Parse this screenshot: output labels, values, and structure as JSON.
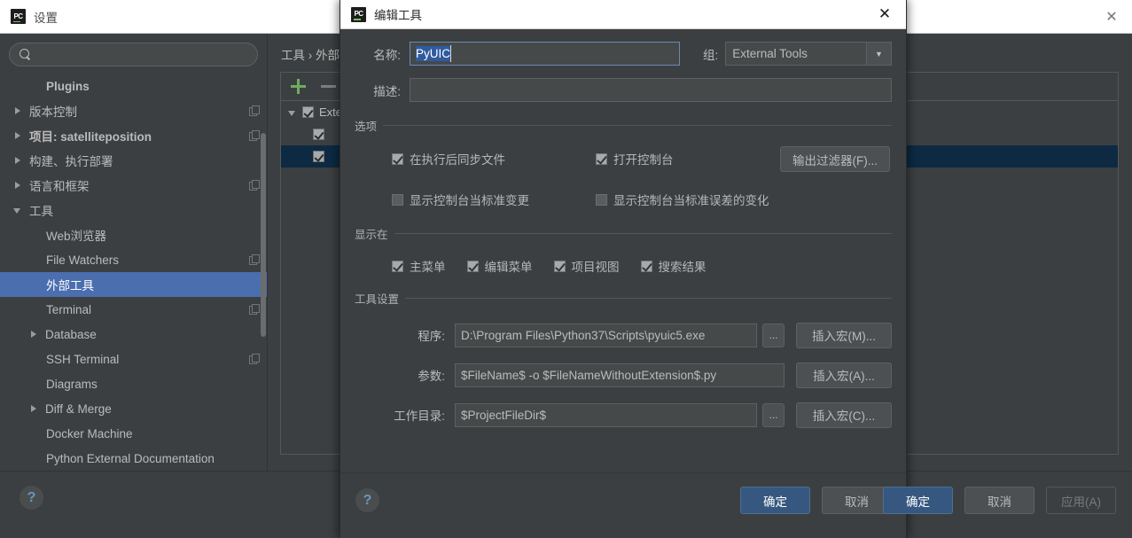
{
  "settings_window": {
    "title": "设置",
    "logo_text": "PC",
    "close_icon": "✕",
    "search": {
      "value": "",
      "placeholder": ""
    },
    "sidebar": {
      "items": [
        {
          "label": "Plugins",
          "arrow": "none",
          "bold": true,
          "indent": true,
          "copy": false,
          "selected": false
        },
        {
          "label": "版本控制",
          "arrow": "closed",
          "bold": false,
          "indent": false,
          "copy": true,
          "selected": false
        },
        {
          "label": "项目: satelliteposition",
          "arrow": "closed",
          "bold": true,
          "indent": false,
          "copy": true,
          "selected": false
        },
        {
          "label": "构建、执行部署",
          "arrow": "closed",
          "bold": false,
          "indent": false,
          "copy": false,
          "selected": false
        },
        {
          "label": "语言和框架",
          "arrow": "closed",
          "bold": false,
          "indent": false,
          "copy": true,
          "selected": false
        },
        {
          "label": "工具",
          "arrow": "open",
          "bold": false,
          "indent": false,
          "copy": false,
          "selected": false
        },
        {
          "label": "Web浏览器",
          "arrow": "none",
          "bold": false,
          "indent": true,
          "copy": false,
          "selected": false
        },
        {
          "label": "File Watchers",
          "arrow": "none",
          "bold": false,
          "indent": true,
          "copy": true,
          "selected": false
        },
        {
          "label": "外部工具",
          "arrow": "none",
          "bold": false,
          "indent": true,
          "copy": false,
          "selected": true
        },
        {
          "label": "Terminal",
          "arrow": "none",
          "bold": false,
          "indent": true,
          "copy": true,
          "selected": false
        },
        {
          "label": "Database",
          "arrow": "closed",
          "bold": false,
          "indent": false,
          "copy": false,
          "selected": false,
          "indent2": true
        },
        {
          "label": "SSH Terminal",
          "arrow": "none",
          "bold": false,
          "indent": true,
          "copy": true,
          "selected": false
        },
        {
          "label": "Diagrams",
          "arrow": "none",
          "bold": false,
          "indent": true,
          "copy": false,
          "selected": false
        },
        {
          "label": "Diff & Merge",
          "arrow": "closed",
          "bold": false,
          "indent": false,
          "copy": false,
          "selected": false,
          "indent2": true
        },
        {
          "label": "Docker Machine",
          "arrow": "none",
          "bold": false,
          "indent": true,
          "copy": false,
          "selected": false
        },
        {
          "label": "Python External Documentation",
          "arrow": "none",
          "bold": false,
          "indent": true,
          "copy": false,
          "selected": false
        }
      ]
    },
    "breadcrumb": "工具 › 外部工具",
    "tool_tree": {
      "add_icon": "add-icon",
      "remove_icon": "remove-icon",
      "root_label": "External Tools",
      "children": [
        "",
        ""
      ]
    },
    "footer": {
      "help_label": "?",
      "ok_label": "确定",
      "cancel_label": "取消",
      "apply_label": "应用(A)"
    }
  },
  "dialog": {
    "title": "编辑工具",
    "logo_text": "PC",
    "close_icon": "✕",
    "name_label": "名称:",
    "name_value": "PyUIC",
    "group_label": "组:",
    "group_value": "External Tools",
    "group_arrow": "▼",
    "desc_label": "描述:",
    "desc_value": "",
    "options": {
      "section_title": "选项",
      "checkboxes": [
        {
          "label": "在执行后同步文件",
          "checked": true
        },
        {
          "label": "打开控制台",
          "checked": true
        },
        {
          "label": "显示控制台当标准变更",
          "checked": false
        },
        {
          "label": "显示控制台当标准误差的变化",
          "checked": false
        }
      ],
      "filter_button": "输出过滤器(F)..."
    },
    "show_in": {
      "section_title": "显示在",
      "checkboxes": [
        {
          "label": "主菜单",
          "checked": true
        },
        {
          "label": "编辑菜单",
          "checked": true
        },
        {
          "label": "项目视图",
          "checked": true
        },
        {
          "label": "搜索结果",
          "checked": true
        }
      ]
    },
    "tool_settings": {
      "section_title": "工具设置",
      "rows": [
        {
          "label": "程序:",
          "value": "D:\\Program Files\\Python37\\Scripts\\pyuic5.exe",
          "has_browse": true,
          "macro": "插入宏(M)..."
        },
        {
          "label": "参数:",
          "value": "$FileName$ -o $FileNameWithoutExtension$.py",
          "has_browse": false,
          "macro": "插入宏(A)..."
        },
        {
          "label": "工作目录:",
          "value": "$ProjectFileDir$",
          "has_browse": true,
          "macro": "插入宏(C)..."
        }
      ],
      "browse_label": "..."
    },
    "footer": {
      "help_label": "?",
      "ok_label": "确定",
      "cancel_label": "取消"
    }
  },
  "colors": {
    "bg": "#3c3f41",
    "selection_blue": "#4b6eaf",
    "primary_button": "#365880",
    "accent_green": "#6ead60",
    "text": "#bbbbbb",
    "tree_selected_row": "#0d2a42"
  }
}
